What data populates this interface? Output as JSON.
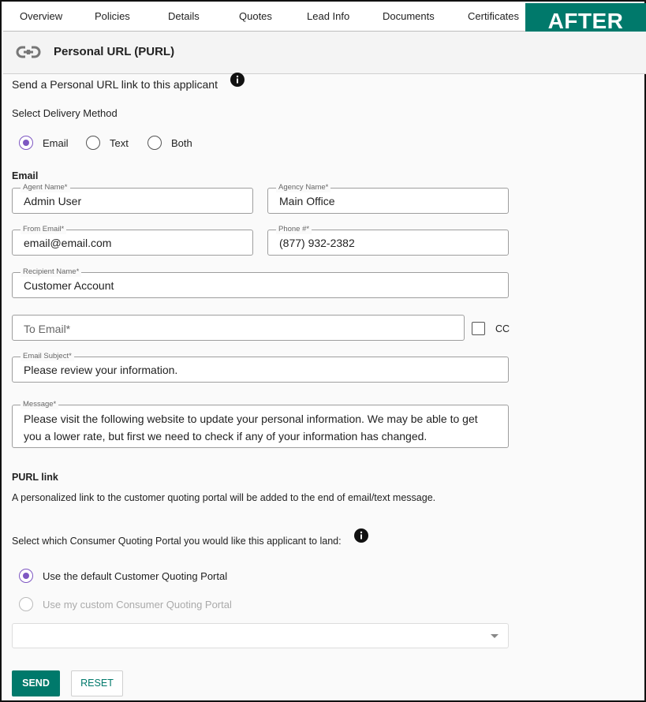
{
  "tabs": [
    "Overview",
    "Policies",
    "Details",
    "Quotes",
    "Lead Info",
    "Documents",
    "Certificates"
  ],
  "badge": "AFTER",
  "header": {
    "title": "Personal URL (PURL)",
    "icon": "link-icon"
  },
  "intro": "Send a Personal URL link to this applicant",
  "delivery": {
    "label": "Select Delivery Method",
    "options": [
      "Email",
      "Text",
      "Both"
    ],
    "selected": "Email"
  },
  "email_section": {
    "heading": "Email",
    "agent_name": {
      "label": "Agent Name*",
      "value": "Admin User"
    },
    "agency_name": {
      "label": "Agency Name*",
      "value": "Main Office"
    },
    "from_email": {
      "label": "From Email*",
      "value": "email@email.com"
    },
    "phone": {
      "label": "Phone #*",
      "value": "(877) 932-2382"
    },
    "recipient_name": {
      "label": "Recipient Name*",
      "value": "Customer Account"
    },
    "to_email": {
      "placeholder": "To Email*",
      "value": ""
    },
    "cc_label": "CC",
    "subject": {
      "label": "Email Subject*",
      "value": "Please review your information."
    },
    "message": {
      "label": "Message*",
      "value": "Please visit the following website to update your personal information. We may be able to get you a lower rate, but first we need to check if any of your information has changed."
    }
  },
  "purl": {
    "heading": "PURL link",
    "description": "A personalized link to the customer quoting portal will be added to the end of email/text message.",
    "portal_label": "Select which Consumer Quoting Portal you would like this applicant to land:",
    "options": [
      "Use the default Customer Quoting Portal",
      "Use my custom Consumer Quoting Portal"
    ],
    "selected": "Use the default Customer Quoting Portal",
    "custom_portal_value": ""
  },
  "buttons": {
    "send": "SEND",
    "reset": "RESET"
  },
  "colors": {
    "accent": "#00796b",
    "radio": "#7e57c2"
  }
}
